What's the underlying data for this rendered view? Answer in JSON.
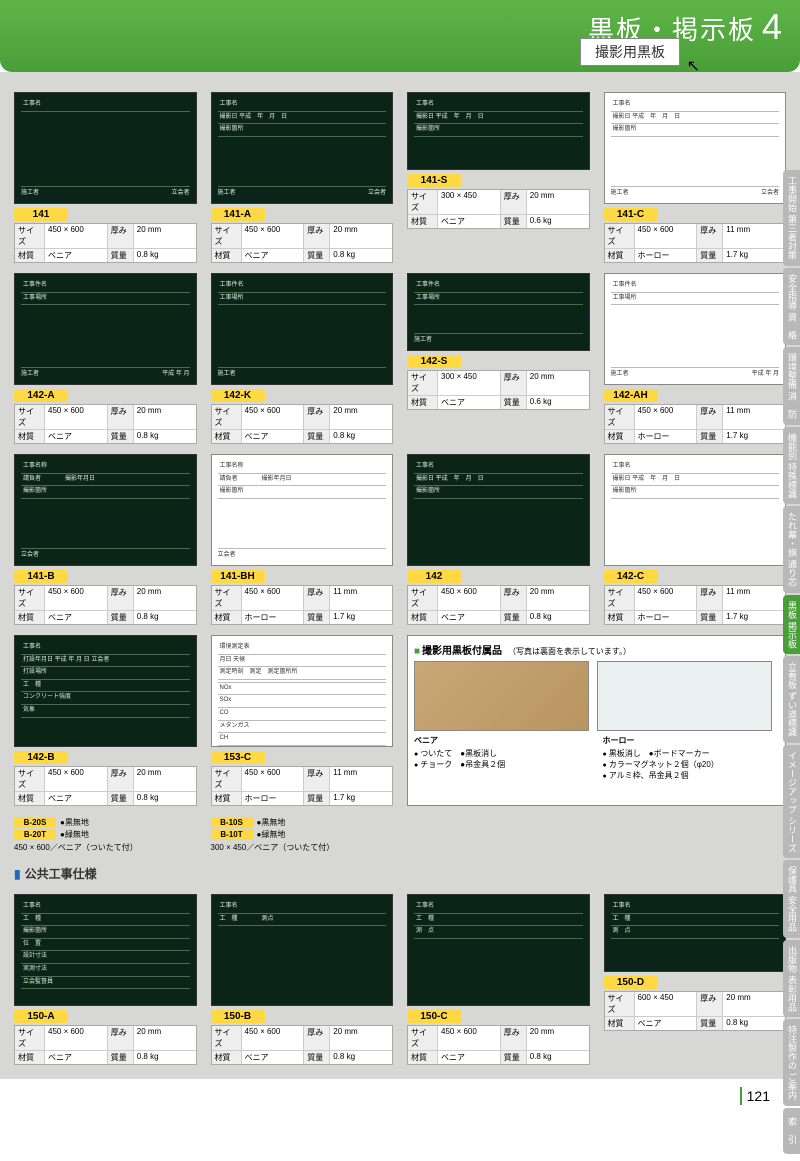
{
  "header": {
    "title": "黒板・掲示板",
    "num": "4",
    "sub": "撮影用黒板"
  },
  "products": [
    {
      "id": "141",
      "size": "450 × 600",
      "thick": "20 mm",
      "mat": "ベニア",
      "mass": "0.8 kg",
      "board": "black",
      "rows": [
        "工事名"
      ],
      "bottom": [
        "施工者",
        "立会者"
      ]
    },
    {
      "id": "141-A",
      "size": "450 × 600",
      "thick": "20 mm",
      "mat": "ベニア",
      "mass": "0.8 kg",
      "board": "black",
      "rows": [
        "工事名",
        "撮影日 平成　年　月　日",
        "撮影箇所"
      ],
      "bottom": [
        "施工者",
        "立会者"
      ]
    },
    {
      "id": "141-S",
      "size": "300 × 450",
      "thick": "20 mm",
      "mat": "ベニア",
      "mass": "0.6 kg",
      "board": "black",
      "small": true,
      "rows": [
        "工事名",
        "撮影日 平成　年　月　日",
        "撮影箇所"
      ]
    },
    {
      "id": "141-C",
      "size": "450 × 600",
      "thick": "11 mm",
      "mat": "ホーロー",
      "mass": "1.7 kg",
      "board": "white",
      "rows": [
        "工事名",
        "撮影日 平成　年　月　日",
        "撮影箇所"
      ],
      "bottom": [
        "施工者",
        "立会者"
      ]
    },
    {
      "id": "142-A",
      "size": "450 × 600",
      "thick": "20 mm",
      "mat": "ベニア",
      "mass": "0.8 kg",
      "board": "black",
      "rows": [
        "工事件名",
        "工事場所"
      ],
      "bottom": [
        "施工者",
        "　　平成 年 月"
      ]
    },
    {
      "id": "142-K",
      "size": "450 × 600",
      "thick": "20 mm",
      "mat": "ベニア",
      "mass": "0.8 kg",
      "board": "black",
      "rows": [
        "工事件名",
        "工事場所"
      ],
      "bottom": [
        "施工者",
        ""
      ]
    },
    {
      "id": "142-S",
      "size": "300 × 450",
      "thick": "20 mm",
      "mat": "ベニア",
      "mass": "0.6 kg",
      "board": "black",
      "small": true,
      "rows": [
        "工事件名",
        "工事場所"
      ],
      "bottom": [
        "施工者",
        ""
      ]
    },
    {
      "id": "142-AH",
      "size": "450 × 600",
      "thick": "11 mm",
      "mat": "ホーロー",
      "mass": "1.7 kg",
      "board": "white",
      "rows": [
        "工事件名",
        "工事場所"
      ],
      "bottom": [
        "施工者",
        "　　平成 年 月"
      ]
    },
    {
      "id": "141-B",
      "size": "450 × 600",
      "thick": "20 mm",
      "mat": "ベニア",
      "mass": "0.8 kg",
      "board": "black",
      "rows": [
        "工事名称",
        "請負者　　　　撮影年月日",
        "撮影箇所"
      ],
      "bottom": [
        "立会者",
        ""
      ]
    },
    {
      "id": "141-BH",
      "size": "450 × 600",
      "thick": "11 mm",
      "mat": "ホーロー",
      "mass": "1.7 kg",
      "board": "white",
      "rows": [
        "工事名称",
        "請負者　　　　撮影年月日",
        "撮影箇所"
      ],
      "bottom": [
        "立会者",
        ""
      ]
    },
    {
      "id": "142",
      "size": "450 × 600",
      "thick": "20 mm",
      "mat": "ベニア",
      "mass": "0.8 kg",
      "board": "black",
      "rows": [
        "工事名",
        "撮影日 平成　年　月　日",
        "撮影箇所"
      ]
    },
    {
      "id": "142-C",
      "size": "450 × 600",
      "thick": "11 mm",
      "mat": "ホーロー",
      "mass": "1.7 kg",
      "board": "white",
      "rows": [
        "工事名",
        "撮影日 平成　年　月　日",
        "撮影箇所"
      ]
    },
    {
      "id": "142-B",
      "size": "450 × 600",
      "thick": "20 mm",
      "mat": "ベニア",
      "mass": "0.8 kg",
      "board": "black",
      "rows": [
        "工事名",
        "打設年月日 平成 年 月 日 立会者",
        "打設場所",
        "工　種",
        "コンクリート強度",
        "気象"
      ]
    },
    {
      "id": "153-C",
      "size": "450 × 600",
      "thick": "11 mm",
      "mat": "ホーロー",
      "mass": "1.7 kg",
      "board": "white",
      "rows": [
        "環境測定表",
        "月日 天候",
        "測定時刻　測定　測定箇所所",
        "",
        "NOx",
        "SOx",
        "CO",
        "メタンガス",
        "CH"
      ]
    }
  ],
  "accessory": {
    "title": "撮影用黒板付属品",
    "note": "（写真は裏面を表示しています。）",
    "cols": [
      {
        "name": "ベニア",
        "items": [
          "ついたて　●黒板消し",
          "チョーク　●吊金具２個"
        ]
      },
      {
        "name": "ホーロー",
        "items": [
          "黒板消し　●ボードマーカー",
          "カラーマグネット２個（φ20）",
          "アルミ枠、吊金具２個"
        ]
      }
    ]
  },
  "variants": [
    {
      "rows": [
        {
          "id": "B-20S",
          "note": "●黒無地"
        },
        {
          "id": "B-20T",
          "note": "●緑無地"
        }
      ],
      "spec": "450 × 600／ベニア（ついたて付）"
    },
    {
      "rows": [
        {
          "id": "B-10S",
          "note": "●黒無地"
        },
        {
          "id": "B-10T",
          "note": "●緑無地"
        }
      ],
      "spec": "300 × 450／ベニア（ついたて付）"
    }
  ],
  "section2": "公共工事仕様",
  "products2": [
    {
      "id": "150-A",
      "size": "450 × 600",
      "thick": "20 mm",
      "mat": "ベニア",
      "mass": "0.8 kg",
      "board": "black",
      "rows": [
        "工事名",
        "工　種",
        "撮影箇所",
        "位　置",
        "設計寸法",
        "実測寸法",
        "立会監督員"
      ]
    },
    {
      "id": "150-B",
      "size": "450 × 600",
      "thick": "20 mm",
      "mat": "ベニア",
      "mass": "0.8 kg",
      "board": "black",
      "rows": [
        "工事名",
        "工　種　　　　測点"
      ]
    },
    {
      "id": "150-C",
      "size": "450 × 600",
      "thick": "20 mm",
      "mat": "ベニア",
      "mass": "0.8 kg",
      "board": "black",
      "rows": [
        "工事名",
        "工　種",
        "測　点"
      ]
    },
    {
      "id": "150-D",
      "size": "600 × 450",
      "thick": "20 mm",
      "mat": "ベニア",
      "mass": "0.8 kg",
      "board": "black",
      "rows": [
        "工事名",
        "工　種",
        "測　点"
      ],
      "small": true
    }
  ],
  "sidetabs": [
    {
      "t": "工事開始\n第三者対策"
    },
    {
      "t": "安全指導\n資　格"
    },
    {
      "t": "環境整備\n消　防"
    },
    {
      "t": "機能別\n特殊標識"
    },
    {
      "t": "たれ幕・旗\n通り芯"
    },
    {
      "t": "黒板\n掲示板",
      "active": true
    },
    {
      "t": "立看板\nずい道標識"
    },
    {
      "t": "イメージアップ\nシリーズ"
    },
    {
      "t": "保護具\n安全用品"
    },
    {
      "t": "出版物\n表彰用品"
    },
    {
      "t": "特注製作の\nご案内"
    },
    {
      "t": "索　引"
    }
  ],
  "pagenum": "121"
}
